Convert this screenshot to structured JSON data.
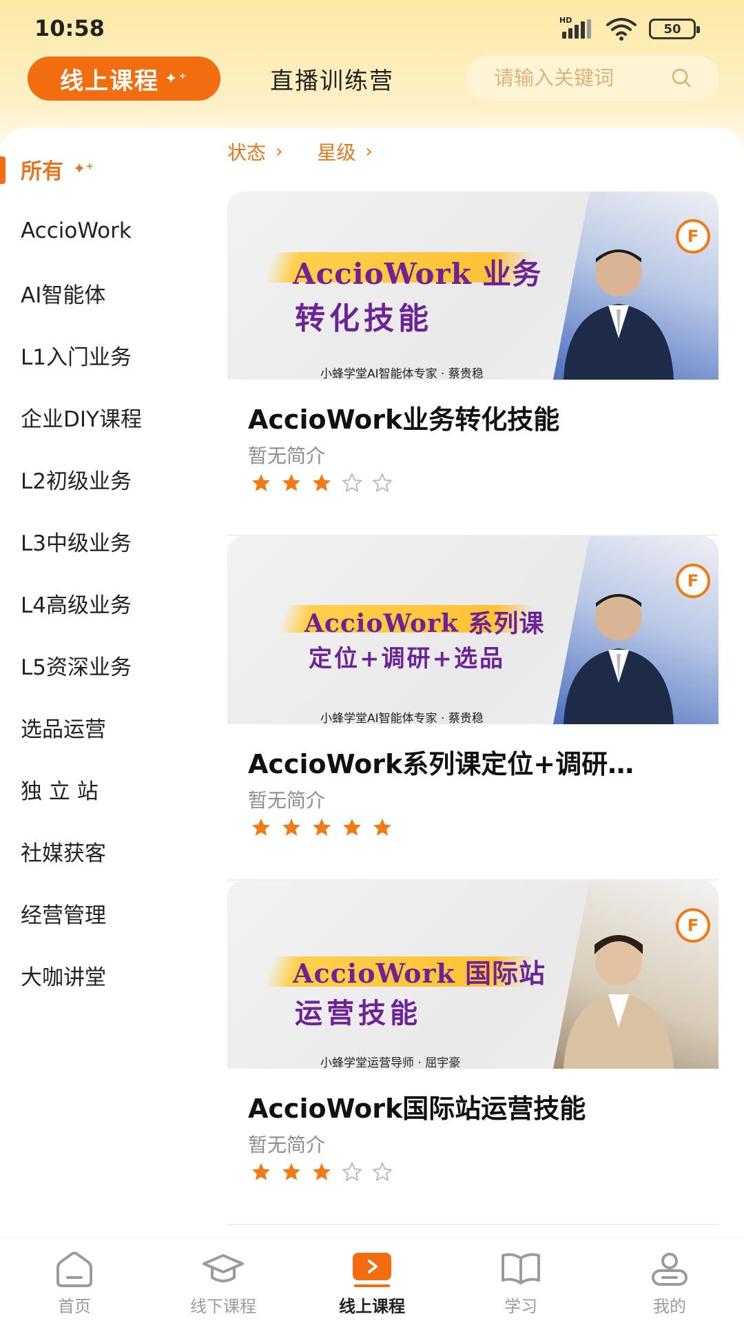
{
  "status_bar": {
    "time": "10:58",
    "battery": "50",
    "network": "HD"
  },
  "top_tabs": {
    "online_label": "线上课程",
    "live_label": "直播训练营"
  },
  "search": {
    "placeholder": "请输入关键词"
  },
  "sidebar": {
    "items": [
      {
        "label": "所有",
        "active": true
      },
      {
        "label": "AccioWork"
      },
      {
        "label": "AI智能体"
      },
      {
        "label": "L1入门业务"
      },
      {
        "label": "企业DIY课程"
      },
      {
        "label": "L2初级业务"
      },
      {
        "label": "L3中级业务"
      },
      {
        "label": "L4高级业务"
      },
      {
        "label": "L5资深业务"
      },
      {
        "label": "选品运营"
      },
      {
        "label": "独 立 站"
      },
      {
        "label": "社媒获客"
      },
      {
        "label": "经营管理"
      },
      {
        "label": "大咖讲堂"
      }
    ]
  },
  "filters": {
    "status_label": "状态",
    "stars_label": "星级"
  },
  "courses": [
    {
      "title": "AccioWork业务转化技能",
      "desc": "暂无简介",
      "rating": 3,
      "thumb_line1": "AccioWork 业务",
      "thumb_line2": "转化技能",
      "thumb_caption": "小蜂学堂AI智能体专家 · 蔡贵稳"
    },
    {
      "title": "AccioWork系列课定位+调研…",
      "desc": "暂无简介",
      "rating": 5,
      "thumb_line1": "AccioWork 系列课",
      "thumb_line2": "定位+调研+选品",
      "thumb_caption": "小蜂学堂AI智能体专家 · 蔡贵稳"
    },
    {
      "title": "AccioWork国际站运营技能",
      "desc": "暂无简介",
      "rating": 3,
      "thumb_line1": "AccioWork 国际站",
      "thumb_line2": "运营技能",
      "thumb_caption": "小蜂学堂运营导师 · 屈宇豪"
    }
  ],
  "bottom_nav": {
    "home": "首页",
    "offline": "线下课程",
    "online": "线上课程",
    "study": "学习",
    "mine": "我的"
  },
  "colors": {
    "accent": "#f26d0f",
    "star": "#f07a16",
    "purple_text": "#6c2396"
  }
}
